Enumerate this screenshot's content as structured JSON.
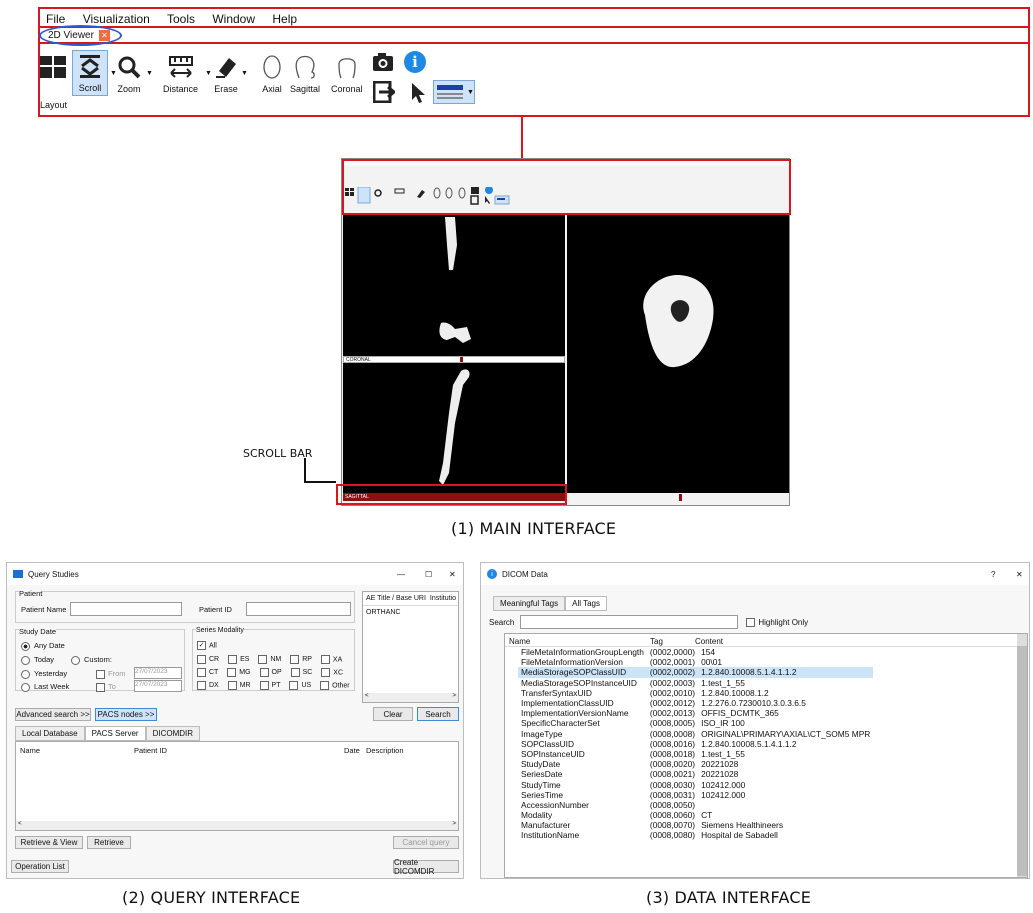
{
  "menu": [
    "File",
    "Visualization",
    "Tools",
    "Window",
    "Help"
  ],
  "tab": {
    "label": "2D Viewer",
    "close": "✕"
  },
  "toolbar": {
    "layout": "Layout",
    "scroll": "Scroll",
    "zoom": "Zoom",
    "distance": "Distance",
    "erase": "Erase",
    "axial": "Axial",
    "sagittal": "Sagittal",
    "coronal": "Coronal"
  },
  "main": {
    "coronal_label": "CORONAL",
    "sagittal_label": "SAGITTAL",
    "scroll_bar_label": "SCROLL BAR",
    "caption": "(1) MAIN INTERFACE"
  },
  "query": {
    "title": "Query Studies",
    "patient_group": "Patient",
    "patient_name": "Patient Name",
    "patient_id": "Patient ID",
    "study_date_group": "Study Date",
    "any_date": "Any Date",
    "today": "Today",
    "custom": "Custom:",
    "yesterday": "Yesterday",
    "from": "From",
    "from_value": "27/07/2023",
    "last_week": "Last Week",
    "to": "To",
    "to_value": "27/07/2023",
    "series_modality": "Series Modality",
    "all": "All",
    "modalities_row1": [
      "CR",
      "ES",
      "NM",
      "RP",
      "XA"
    ],
    "modalities_row2": [
      "CT",
      "MG",
      "OP",
      "SC",
      "XC"
    ],
    "modalities_row3": [
      "DX",
      "MR",
      "PT",
      "US",
      "Other"
    ],
    "ae_header1": "AE Title / Base URI",
    "ae_header2": "Institutio",
    "ae_value": "ORTHANC",
    "advanced_search": "Advanced search >>",
    "pacs_nodes": "PACS nodes >>",
    "clear": "Clear",
    "search": "Search",
    "tab_local": "Local Database",
    "tab_pacs": "PACS Server",
    "tab_dicomdir": "DICOMDIR",
    "col_name": "Name",
    "col_patient_id": "Patient ID",
    "col_date": "Date",
    "col_description": "Description",
    "retrieve_view": "Retrieve & View",
    "retrieve": "Retrieve",
    "cancel_query": "Cancel query",
    "operation_list": "Operation List",
    "create_dicomdir": "Create DICOMDIR",
    "caption": "(2) QUERY INTERFACE"
  },
  "dicom": {
    "title": "DICOM Data",
    "help": "?",
    "close": "✕",
    "tab_meaningful": "Meaningful Tags",
    "tab_all": "All Tags",
    "search_label": "Search",
    "highlight_only": "Highlight Only",
    "col_name": "Name",
    "col_tag": "Tag",
    "col_content": "Content",
    "rows": [
      [
        "FileMetaInformationGroupLength",
        "(0002,0000)",
        "154"
      ],
      [
        "FileMetaInformationVersion",
        "(0002,0001)",
        "00\\01"
      ],
      [
        "MediaStorageSOPClassUID",
        "(0002,0002)",
        "1.2.840.10008.5.1.4.1.1.2"
      ],
      [
        "MediaStorageSOPInstanceUID",
        "(0002,0003)",
        "1.test_1_55"
      ],
      [
        "TransferSyntaxUID",
        "(0002,0010)",
        "1.2.840.10008.1.2"
      ],
      [
        "ImplementationClassUID",
        "(0002,0012)",
        "1.2.276.0.7230010.3.0.3.6.5"
      ],
      [
        "ImplementationVersionName",
        "(0002,0013)",
        "OFFIS_DCMTK_365"
      ],
      [
        "SpecificCharacterSet",
        "(0008,0005)",
        "ISO_IR 100"
      ],
      [
        "ImageType",
        "(0008,0008)",
        "ORIGINAL\\PRIMARY\\AXIAL\\CT_SOM5 MPR"
      ],
      [
        "SOPClassUID",
        "(0008,0016)",
        "1.2.840.10008.5.1.4.1.1.2"
      ],
      [
        "SOPInstanceUID",
        "(0008,0018)",
        "1.test_1_55"
      ],
      [
        "StudyDate",
        "(0008,0020)",
        "20221028"
      ],
      [
        "SeriesDate",
        "(0008,0021)",
        "20221028"
      ],
      [
        "StudyTime",
        "(0008,0030)",
        "102412.000"
      ],
      [
        "SeriesTime",
        "(0008,0031)",
        "102412.000"
      ],
      [
        "AccessionNumber",
        "(0008,0050)",
        ""
      ],
      [
        "Modality",
        "(0008,0060)",
        "CT"
      ],
      [
        "Manufacturer",
        "(0008,0070)",
        "Siemens Healthineers"
      ],
      [
        "InstitutionName",
        "(0008,0080)",
        "Hospital de Sabadell"
      ]
    ],
    "caption": "(3) DATA INTERFACE"
  },
  "colors": {
    "highlight": "#d8161b",
    "oval": "#2a5bd7",
    "row_selected": "#cce4f7",
    "accent": "#1e88e5"
  }
}
